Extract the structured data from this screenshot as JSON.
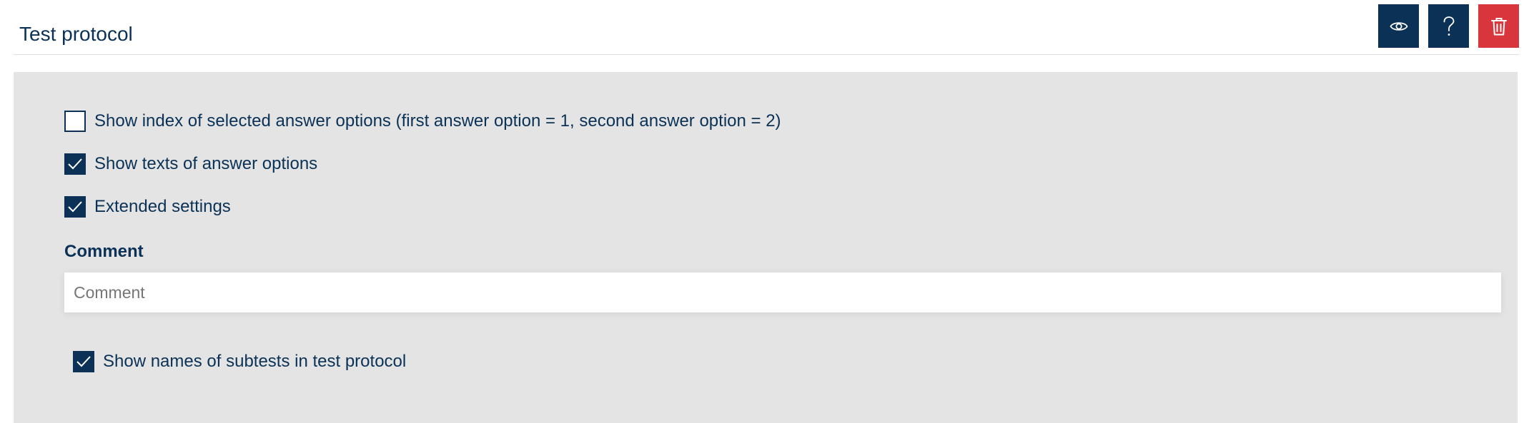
{
  "header": {
    "title": "Test protocol",
    "buttons": [
      {
        "name": "preview-button",
        "icon": "eye-icon",
        "color": "#0b3256"
      },
      {
        "name": "help-button",
        "icon": "question-icon",
        "color": "#0b3256"
      },
      {
        "name": "delete-button",
        "icon": "trash-icon",
        "color": "#d9353d"
      }
    ]
  },
  "options": {
    "show_index": {
      "label": "Show index of selected answer options (first answer option = 1, second answer option = 2)",
      "checked": false
    },
    "show_texts": {
      "label": "Show texts of answer options",
      "checked": true
    },
    "extended_settings": {
      "label": "Extended settings",
      "checked": true
    }
  },
  "comment": {
    "label": "Comment",
    "placeholder": "Comment",
    "value": ""
  },
  "extended": {
    "show_subtest_names": {
      "label": "Show names of subtests in test protocol",
      "checked": true
    }
  },
  "colors": {
    "primary": "#0b3256",
    "danger": "#d9353d",
    "panel_background": "#e4e4e4"
  }
}
